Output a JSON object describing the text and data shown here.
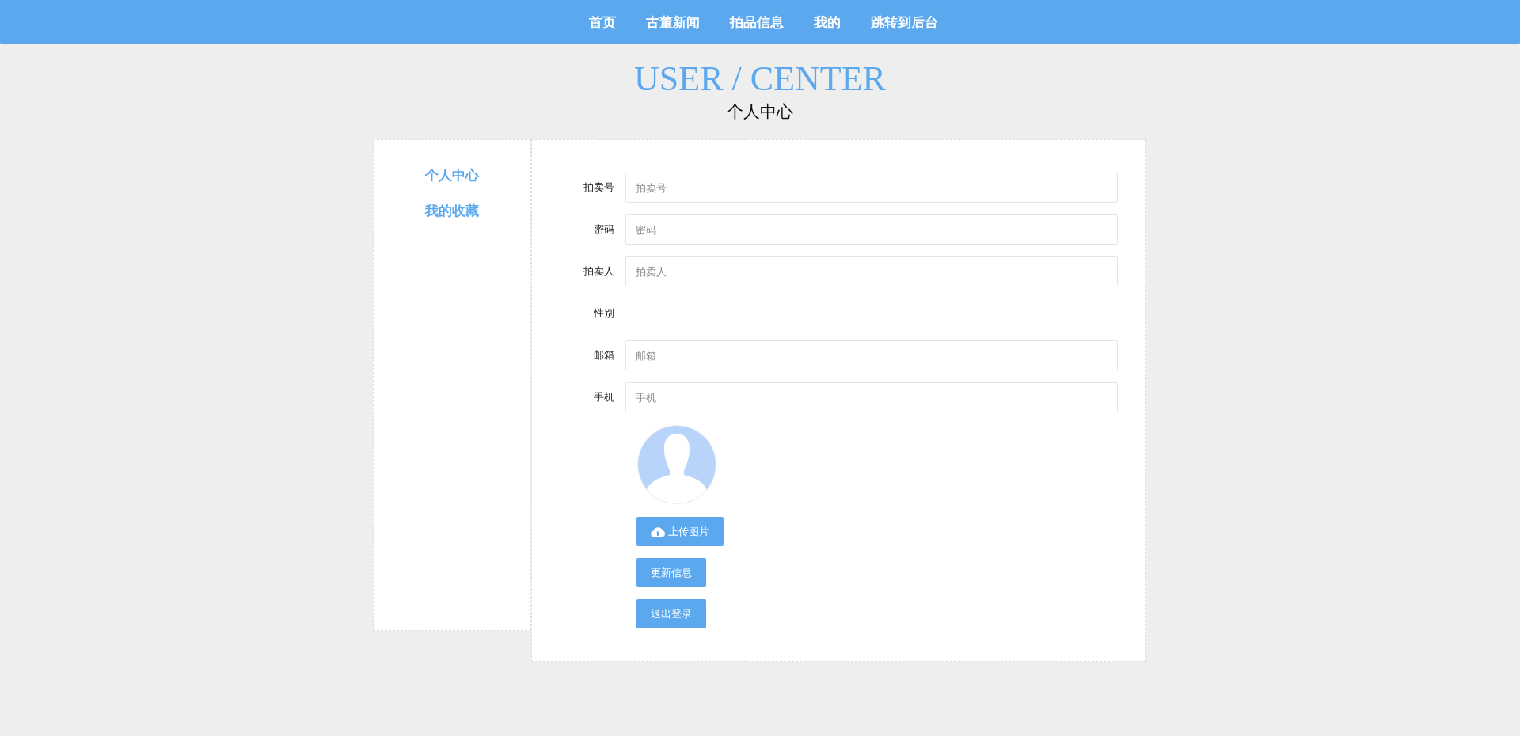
{
  "nav": {
    "items": [
      "首页",
      "古董新闻",
      "拍品信息",
      "我的",
      "跳转到后台"
    ]
  },
  "heading": {
    "title": "USER / CENTER",
    "subtitle": "个人中心"
  },
  "sidebar": {
    "items": [
      "个人中心",
      "我的收藏"
    ]
  },
  "form": {
    "fields": [
      {
        "kind": "input",
        "label": "拍卖号",
        "placeholder": "拍卖号"
      },
      {
        "kind": "input",
        "label": "密码",
        "placeholder": "密码"
      },
      {
        "kind": "input",
        "label": "拍卖人",
        "placeholder": "拍卖人"
      },
      {
        "kind": "empty",
        "label": "性别"
      },
      {
        "kind": "input",
        "label": "邮箱",
        "placeholder": "邮箱"
      },
      {
        "kind": "input",
        "label": "手机",
        "placeholder": "手机"
      }
    ],
    "buttons": [
      {
        "kind": "upload",
        "label": "上传图片"
      },
      {
        "kind": "plain",
        "label": "更新信息"
      },
      {
        "kind": "plain",
        "label": "退出登录"
      }
    ]
  }
}
